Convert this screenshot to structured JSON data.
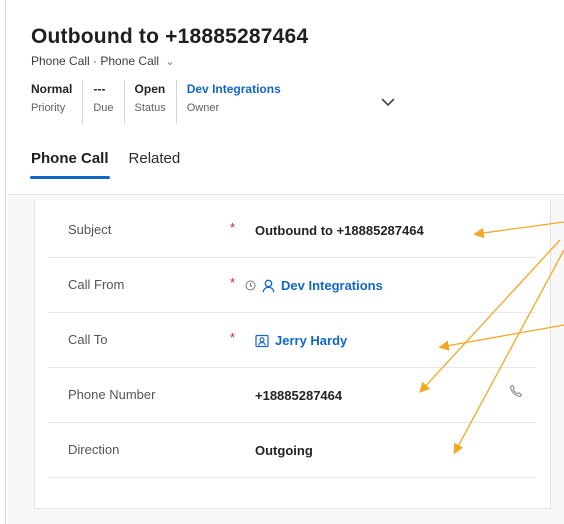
{
  "header": {
    "title": "Outbound to +18885287464",
    "subtitle": "Phone Call · Phone Call",
    "fields": [
      {
        "value": "Normal",
        "label": "Priority"
      },
      {
        "value": "---",
        "label": "Due"
      },
      {
        "value": "Open",
        "label": "Status"
      },
      {
        "value": "Dev Integrations",
        "label": "Owner"
      }
    ]
  },
  "tabs": [
    "Phone Call",
    "Related"
  ],
  "form": {
    "subject": {
      "label": "Subject",
      "required": "*",
      "value": "Outbound to +18885287464"
    },
    "call_from": {
      "label": "Call From",
      "required": "*",
      "value": "Dev Integrations"
    },
    "call_to": {
      "label": "Call To",
      "required": "*",
      "value": "Jerry Hardy"
    },
    "phone_number": {
      "label": "Phone Number",
      "value": "+18885287464"
    },
    "direction": {
      "label": "Direction",
      "value": "Outgoing"
    }
  },
  "colors": {
    "accent": "#1167c8",
    "required": "#c4262e",
    "annotation_arrow": "#f5a623"
  }
}
